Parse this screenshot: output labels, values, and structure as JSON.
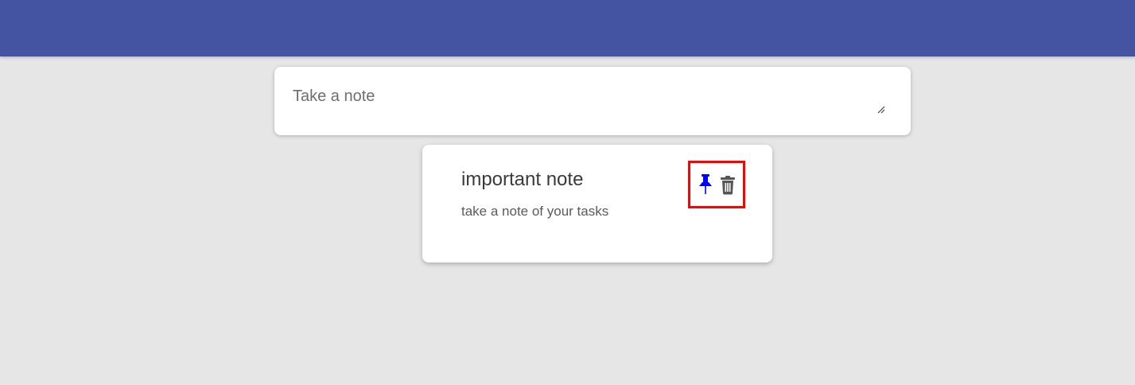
{
  "colors": {
    "header": "#4553a3",
    "background": "#e6e6e6",
    "card": "#ffffff",
    "pin_icon": "#0000ff",
    "delete_icon": "#555555",
    "highlight_border": "#ff0000"
  },
  "compose": {
    "placeholder": "Take a note",
    "value": ""
  },
  "notes": [
    {
      "title": "important note",
      "content": "take a note of your tasks",
      "pin_icon": "pushpin-icon",
      "delete_icon": "trash-icon"
    }
  ]
}
